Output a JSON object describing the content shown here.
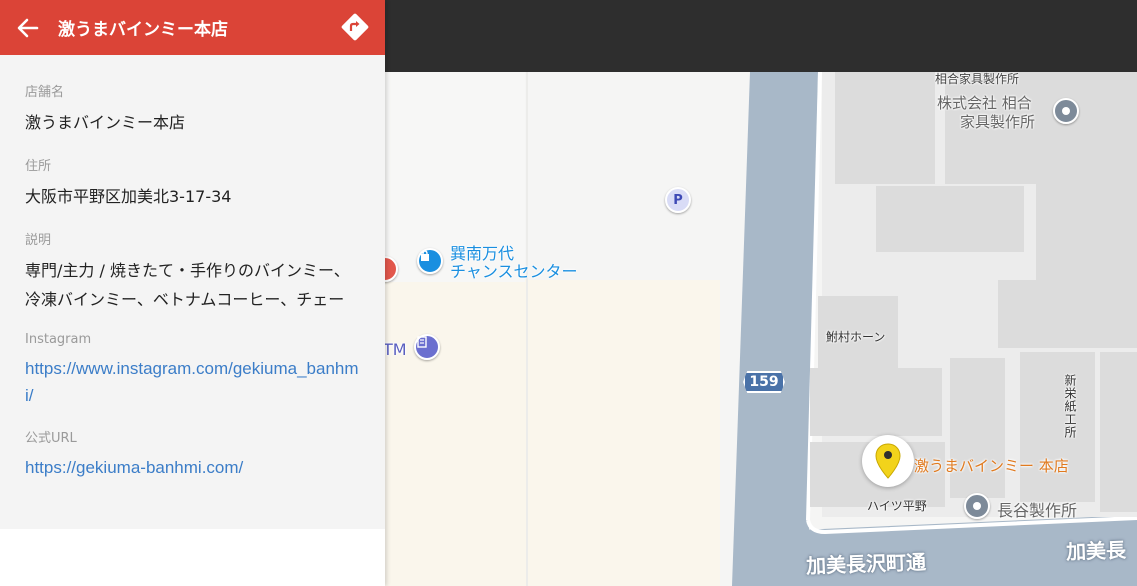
{
  "panel": {
    "title": "激うまバインミー本店",
    "fields": {
      "name_label": "店舗名",
      "name_value": "激うまバインミー本店",
      "address_label": "住所",
      "address_value": "大阪市平野区加美北3-17-34",
      "description_label": "説明",
      "description_value": "専門/主力 / 焼きたて・手作りのバインミー、冷凍バインミー、ベトナムコーヒー、チェー",
      "instagram_label": "Instagram",
      "instagram_url": "https://www.instagram.com/gekiuma_banhmi/",
      "official_label": "公式URL",
      "official_url": "https://gekiuma-banhmi.com/"
    }
  },
  "map": {
    "labels": {
      "aigou_small": "相合家具製作所",
      "aigou_poi_line1": "株式会社 相合",
      "aigou_poi_line2": "家具製作所",
      "tatsumi_line1": "巽南万代",
      "tatsumi_line2": "チャンスセンター",
      "atm_partial": "TM",
      "route_number": "159",
      "ajimura": "鮒村ホーン",
      "shinsei": "新栄紙工所",
      "target_name": "激うまバインミー 本店",
      "heights": "ハイツ平野",
      "hase": "長谷製作所",
      "road_main": "加美長沢町通",
      "road_right": "加美長",
      "parking": "P"
    },
    "colors": {
      "header_red": "#db4437",
      "water_road": "#a8b8c8",
      "poi_blue": "#1a8fe0",
      "poi_purple": "#6b6fcf",
      "target_orange": "#e07a1f",
      "pin_yellow": "#f2d31b"
    }
  }
}
